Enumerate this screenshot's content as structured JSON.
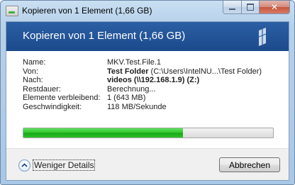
{
  "window": {
    "title": "Kopieren von 1 Element (1,66 GB)",
    "minimize_icon": "minimize-icon",
    "maximize_icon": "maximize-icon",
    "close_icon": "close-icon",
    "close_glyph": "✕"
  },
  "header": {
    "title": "Kopieren von 1 Element (1,66 GB)",
    "accent_color": "#1f4f93"
  },
  "details": {
    "name": {
      "label": "Name:",
      "value": "MKV.Test.File.1"
    },
    "von": {
      "label": "Von:",
      "value_bold": "Test Folder",
      "value_rest": " (C:\\Users\\IntelNU...\\Test Folder)"
    },
    "nach": {
      "label": "Nach:",
      "value_bold": "videos (\\\\192.168.1.9) (Z:)"
    },
    "restdauer": {
      "label": "Restdauer:",
      "value": "Berechnung..."
    },
    "elemente": {
      "label": "Elemente verbleibend:",
      "value": "1 (643 MB)"
    },
    "geschwindigkeit": {
      "label": "Geschwindigkeit:",
      "value": "118 MB/Sekunde"
    }
  },
  "progress": {
    "fraction": 0.64,
    "color": "#2fc22b"
  },
  "footer": {
    "details_toggle_label": "Weniger Details",
    "details_toggle_icon": "chevron-up-icon",
    "cancel_label": "Abbrechen"
  }
}
